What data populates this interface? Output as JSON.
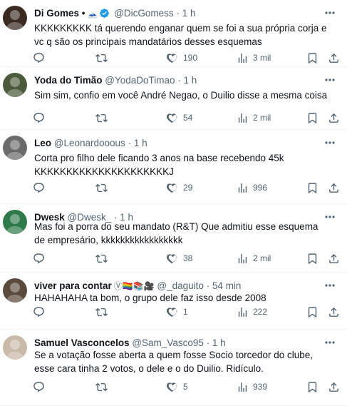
{
  "tweets": [
    {
      "name": "Di Gomes •",
      "extra": "🗻",
      "verified": true,
      "handle": "@DicGomess",
      "time": "1 h",
      "text": "KKKKKKKKK tá querendo enganar quem se foi a sua própria corja e vc q são os principais mandatários desses esquemas",
      "replies": "",
      "retweets": "",
      "likes": "190",
      "views": "3 mil",
      "avatar_color": "#3a2a22"
    },
    {
      "name": "Yoda do Timão",
      "extra": "",
      "verified": false,
      "handle": "@YodaDoTimao",
      "time": "1 h",
      "text": "Sim sim, confio em você André Negao, o Duilio disse a mesma coisa",
      "replies": "",
      "retweets": "",
      "likes": "54",
      "views": "2 mil",
      "avatar_color": "#4a5a3a"
    },
    {
      "name": "Leo",
      "extra": "",
      "verified": false,
      "handle": "@Leonardooous",
      "time": "1 h",
      "text": "Corta pro filho dele ficando 3 anos na base recebendo 45k KKKKKKKKKKKKKKKKKKKKKJ",
      "replies": "",
      "retweets": "",
      "likes": "29",
      "views": "996",
      "avatar_color": "#6b6b6b"
    },
    {
      "name": "Dwesk",
      "extra": "",
      "verified": false,
      "handle": "@Dwesk_",
      "time": "1 h",
      "text": "Mas foi a porra do seu mandato (R&T) Que admitiu esse esquema de empresário, kkkkkkkkkkkkkkkkk",
      "replies": "",
      "retweets": "",
      "likes": "38",
      "views": "2 mil",
      "avatar_color": "#2f7a4a"
    },
    {
      "name": "viver para contar",
      "extra": "Ⓥ🏳️‍🌈📚🎥",
      "verified": false,
      "handle": "@_daguito",
      "time": "54 min",
      "text": "HAHAHAHA ta bom, o grupo dele faz isso desde 2008",
      "replies": "",
      "retweets": "",
      "likes": "1",
      "views": "222",
      "avatar_color": "#5a4a3e"
    },
    {
      "name": "Samuel Vasconcelos",
      "extra": "",
      "verified": false,
      "handle": "@Sam_Vasco95",
      "time": "1 h",
      "text": "Se a votação fosse aberta a quem fosse Socio torcedor do clube, esse cara tinha 2 votos, o dele e o do Duilio. Ridículo.",
      "replies": "",
      "retweets": "",
      "likes": "5",
      "views": "939",
      "avatar_color": "#c9b9a8"
    }
  ],
  "colors": {
    "text": "#0f1419",
    "muted": "#536471",
    "divider": "#eff3f4",
    "verified": "#1d9bf0"
  }
}
